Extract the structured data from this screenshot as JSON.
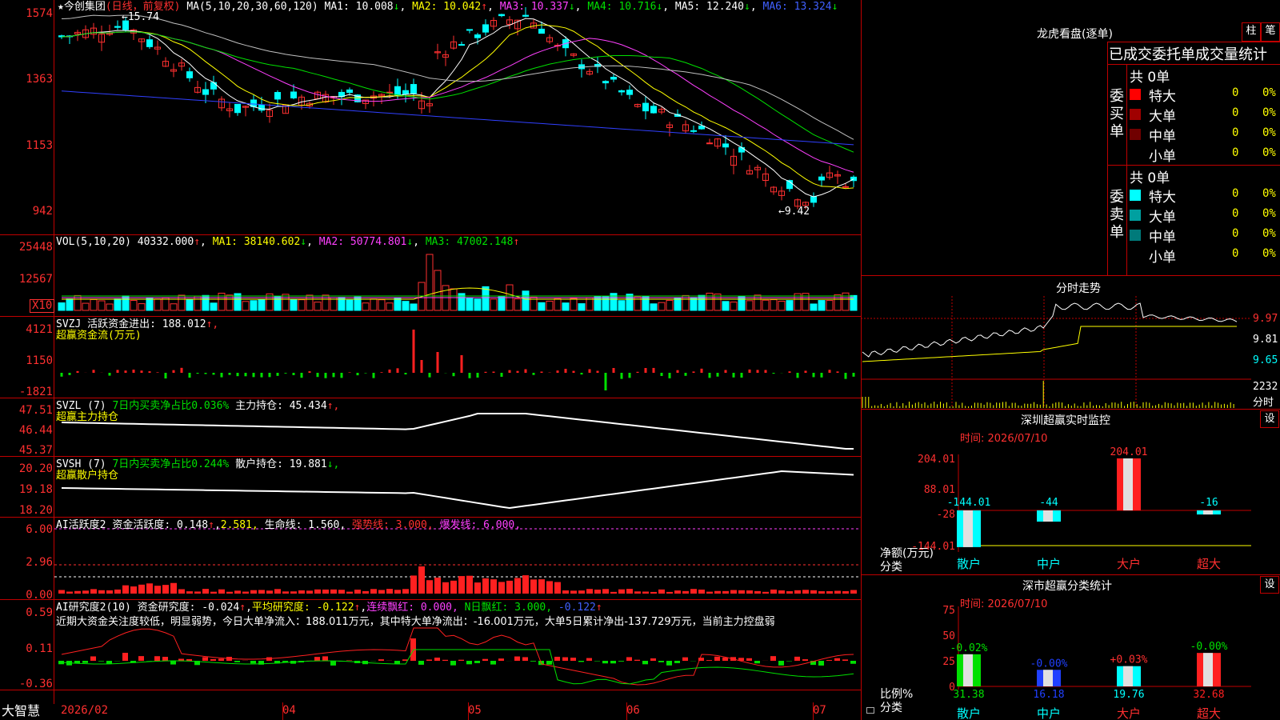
{
  "kline": {
    "star": "★",
    "name": "今创集团",
    "period": "(日线，前复权)",
    "ma_label": "MA(5,10,20,30,60,120)",
    "ma": [
      {
        "label": "MA1:",
        "value": "10.008",
        "arrow": "↓"
      },
      {
        "label": "MA2:",
        "value": "10.042",
        "arrow": "↑"
      },
      {
        "label": "MA3:",
        "value": "10.337",
        "arrow": "↓"
      },
      {
        "label": "MA4:",
        "value": "10.716",
        "arrow": "↓"
      },
      {
        "label": "MA5:",
        "value": "12.240",
        "arrow": "↓"
      },
      {
        "label": "MA6:",
        "value": "13.324",
        "arrow": "↓"
      }
    ],
    "y_ticks": [
      "1574",
      "1363",
      "1153",
      "942"
    ],
    "high_label": "15.74",
    "low_label": "9.42",
    "ma_colors": [
      "#ffffff",
      "#ffff00",
      "#ff40ff",
      "#00e000",
      "#c0c0c0",
      "#3040ff"
    ]
  },
  "vol": {
    "title": "VOL(5,10,20)",
    "value": "40332.000",
    "arrow": "↑",
    "ma": [
      {
        "label": "MA1:",
        "value": "38140.602",
        "arrow": "↓"
      },
      {
        "label": "MA2:",
        "value": "50774.801",
        "arrow": "↓"
      },
      {
        "label": "MA3:",
        "value": "47002.148",
        "arrow": "↑"
      }
    ],
    "y_ticks": [
      "25448",
      "12567"
    ],
    "unit": "X10"
  },
  "svzj": {
    "title": "SVZJ",
    "label": "活跃资金进出:",
    "value": "188.012",
    "arrow": "↑,",
    "subtitle": "超赢资金流(万元)",
    "y_ticks": [
      "4121",
      "1150",
      "-1821"
    ]
  },
  "svzl": {
    "title": "SVZL (7)",
    "text1": "7日内买卖净占比0.036%",
    "label": "主力持仓:",
    "value": "45.434",
    "arrow": "↑,",
    "subtitle": "超赢主力持仓",
    "y_ticks": [
      "47.51",
      "46.44",
      "45.37"
    ]
  },
  "svsh": {
    "title": "SVSH (7)",
    "text1": "7日内买卖净占比0.244%",
    "label": "散户持仓:",
    "value": "19.881",
    "arrow": "↓,",
    "subtitle": "超赢散户持仓",
    "y_ticks": [
      "20.20",
      "19.18",
      "18.20"
    ]
  },
  "ai_active": {
    "title": "AI活跃度2",
    "label": "资金活跃度:",
    "value": "0.148",
    "v2": "2.581,",
    "life_label": "生命线:",
    "life_value": "1.560,",
    "strong_label": "强势线:",
    "strong_value": "3.000,",
    "burst_label": "爆发线:",
    "burst_value": "6.000,",
    "y_ticks": [
      "6.00",
      "2.96",
      "0.00"
    ]
  },
  "ai_research": {
    "title": "AI研究度2(10)",
    "label": "资金研究度:",
    "value": "-0.024",
    "avg_label": "平均研究度:",
    "avg_value": "-0.122",
    "cont_label": "连续飘红:",
    "cont_value": "0.000,",
    "n_label": "N日飘红:",
    "n_value": "3.000,",
    "last_value": "-0.122",
    "comment": "近期大资金关注度较低，明显弱势，今日大单净流入：188.011万元，其中特大单净流出：-16.001万元，大单5日累计净出-137.729万元，当前主力控盘弱",
    "y_ticks": [
      "0.59",
      "0.11",
      "-0.36"
    ]
  },
  "xaxis": {
    "logo": "大智慧",
    "labels": [
      "2026/02",
      "04",
      "05",
      "06",
      "07"
    ]
  },
  "dragon": {
    "title": "龙虎看盘(逐单)",
    "btn1": "柱",
    "btn2": "笔",
    "header": "已成交委托单成交量统计",
    "buy_side": "委买单",
    "sell_side": "委卖单",
    "total_buy": "共 0单",
    "total_sell": "共 0单",
    "rows_buy": [
      {
        "name": "特大",
        "count": "0",
        "pct": "0%",
        "color": "#ff0000"
      },
      {
        "name": "大单",
        "count": "0",
        "pct": "0%",
        "color": "#a00000"
      },
      {
        "name": "中单",
        "count": "0",
        "pct": "0%",
        "color": "#700000"
      },
      {
        "name": "小单",
        "count": "0",
        "pct": "0%",
        "color": ""
      }
    ],
    "rows_sell": [
      {
        "name": "特大",
        "count": "0",
        "pct": "0%",
        "color": "#00ffff"
      },
      {
        "name": "大单",
        "count": "0",
        "pct": "0%",
        "color": "#00a0a0"
      },
      {
        "name": "中单",
        "count": "0",
        "pct": "0%",
        "color": "#007a7a"
      },
      {
        "name": "小单",
        "count": "0",
        "pct": "0%",
        "color": ""
      }
    ]
  },
  "intraday": {
    "title": "分时走势",
    "y_ticks": [
      "9.97",
      "9.81",
      "9.65"
    ],
    "vol_tick": "2232",
    "vol_label": "分时"
  },
  "monitor": {
    "title": "深圳超赢实时监控",
    "btn": "设",
    "time": "时间: 2026/07/10",
    "y_ticks": [
      "204.01",
      "88.01",
      "-28",
      "-144.01"
    ],
    "ylabel1": "净额(万元)",
    "ylabel2": "分类",
    "categories": [
      "散户",
      "中户",
      "大户",
      "超大"
    ],
    "values": [
      "-144.01",
      "-44",
      "204.01",
      "-16"
    ],
    "chart_data": {
      "type": "bar",
      "categories": [
        "散户",
        "中户",
        "大户",
        "超大"
      ],
      "values": [
        -144.01,
        -44,
        204.01,
        -16
      ],
      "ylabel": "净额(万元)",
      "ylim": [
        -144.01,
        204.01
      ]
    }
  },
  "classify": {
    "title": "深市超赢分类统计",
    "btn": "设",
    "time": "时间: 2026/07/10",
    "y_ticks": [
      "75",
      "50",
      "25",
      "0"
    ],
    "ylabel1": "比例%",
    "ylabel2": "分类",
    "categories": [
      "散户",
      "中户",
      "大户",
      "超大"
    ],
    "values": [
      "31.38",
      "16.18",
      "19.76",
      "32.68"
    ],
    "changes": [
      "-0.02%",
      "-0.00%",
      "+0.03%",
      "-0.00%"
    ],
    "chart_data": {
      "type": "bar",
      "categories": [
        "散户",
        "中户",
        "大户",
        "超大"
      ],
      "values": [
        31.38,
        16.18,
        19.76,
        32.68
      ],
      "ylabel": "比例%",
      "ylim": [
        0,
        75
      ]
    }
  }
}
